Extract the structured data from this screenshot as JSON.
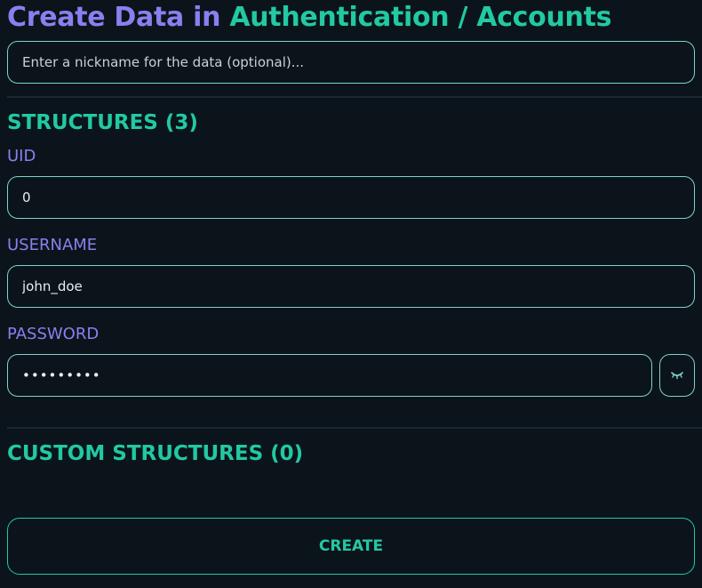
{
  "header": {
    "title_prefix": "Create Data in",
    "title_path": "Authentication / Accounts"
  },
  "nickname": {
    "placeholder": "Enter a nickname for the data (optional)...",
    "value": ""
  },
  "structures": {
    "heading": "STRUCTURES (3)",
    "fields": [
      {
        "label": "UID",
        "value": "0"
      },
      {
        "label": "USERNAME",
        "value": "john_doe"
      },
      {
        "label": "PASSWORD",
        "value": "masked123"
      }
    ],
    "password_toggle_icon": "eye-closed-icon"
  },
  "custom_structures": {
    "heading": "CUSTOM STRUCTURES (0)"
  },
  "actions": {
    "create_label": "CREATE"
  },
  "colors": {
    "background": "#0b141a",
    "accent_teal": "#22c9a3",
    "accent_purple": "#8b7ff0",
    "input_border": "#7fd3c5"
  }
}
